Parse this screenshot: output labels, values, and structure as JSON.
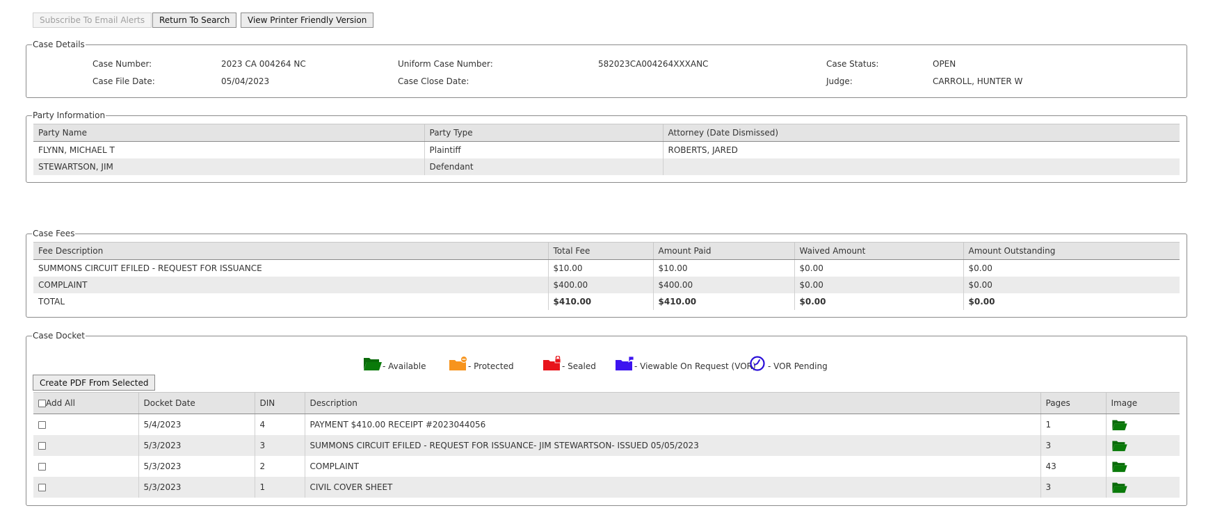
{
  "toolbar": {
    "subscribe_label": "Subscribe To Email Alerts",
    "return_label": "Return To Search",
    "printer_label": "View Printer Friendly Version"
  },
  "case_details": {
    "legend": "Case Details",
    "case_number_label": "Case Number:",
    "case_number": "2023 CA 004264 NC",
    "uniform_case_number_label": "Uniform Case Number:",
    "uniform_case_number": "582023CA004264XXXANC",
    "case_status_label": "Case Status:",
    "case_status": "OPEN",
    "case_file_date_label": "Case File Date:",
    "case_file_date": "05/04/2023",
    "case_close_date_label": "Case Close Date:",
    "case_close_date": "",
    "judge_label": "Judge:",
    "judge": "CARROLL, HUNTER W"
  },
  "party_information": {
    "legend": "Party Information",
    "headers": [
      "Party Name",
      "Party Type",
      "Attorney (Date Dismissed)"
    ],
    "rows": [
      [
        "FLYNN, MICHAEL T",
        "Plaintiff",
        "ROBERTS, JARED"
      ],
      [
        "STEWARTSON, JIM",
        "Defendant",
        ""
      ]
    ]
  },
  "case_fees": {
    "legend": "Case Fees",
    "headers": [
      "Fee Description",
      "Total Fee",
      "Amount Paid",
      "Waived Amount",
      "Amount Outstanding"
    ],
    "rows": [
      [
        "SUMMONS CIRCUIT EFILED - REQUEST FOR ISSUANCE",
        "$10.00",
        "$10.00",
        "$0.00",
        "$0.00"
      ],
      [
        "COMPLAINT",
        "$400.00",
        "$400.00",
        "$0.00",
        "$0.00"
      ],
      [
        "TOTAL",
        "$410.00",
        "$410.00",
        "$0.00",
        "$0.00"
      ]
    ]
  },
  "case_docket": {
    "legend": "Case Docket",
    "status_legend": [
      {
        "label": "- Available",
        "icon": "folder-open-icon",
        "color": "#0a7a0a"
      },
      {
        "label": "- Protected",
        "icon": "folder-protected-icon",
        "color": "#f7941d"
      },
      {
        "label": "- Sealed",
        "icon": "folder-sealed-icon",
        "color": "#e8141b"
      },
      {
        "label": "- Viewable On Request (VOR)",
        "icon": "folder-vor-icon",
        "color": "#3d14f0"
      },
      {
        "label": "- VOR Pending",
        "icon": "clock-icon",
        "color": "#2a0fd8"
      }
    ],
    "create_pdf_label": "Create PDF From Selected",
    "headers": [
      "Add All",
      "Docket Date",
      "DIN",
      "Description",
      "Pages",
      "Image"
    ],
    "rows": [
      {
        "docket_date": "5/4/2023",
        "din": "4",
        "description": "PAYMENT $410.00 RECEIPT #2023044056",
        "pages": "1"
      },
      {
        "docket_date": "5/3/2023",
        "din": "3",
        "description": "SUMMONS CIRCUIT EFILED - REQUEST FOR ISSUANCE- JIM STEWARTSON- ISSUED 05/05/2023",
        "pages": "3"
      },
      {
        "docket_date": "5/3/2023",
        "din": "2",
        "description": "COMPLAINT",
        "pages": "43"
      },
      {
        "docket_date": "5/3/2023",
        "din": "1",
        "description": "CIVIL COVER SHEET",
        "pages": "3"
      }
    ]
  }
}
